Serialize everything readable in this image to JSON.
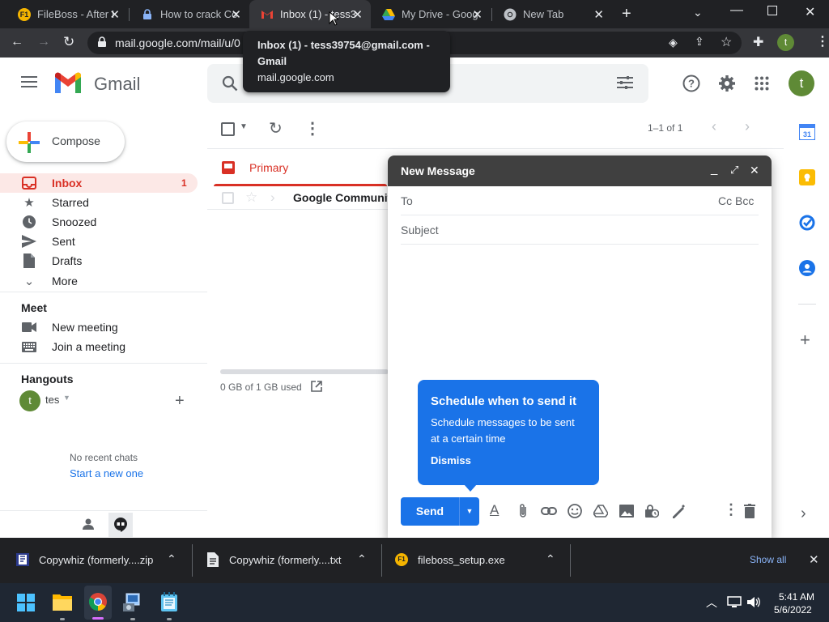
{
  "browser": {
    "tabs": [
      {
        "title": "FileBoss - After I",
        "favicon": "fileboss-icon",
        "favicon_text": "F1",
        "active": false
      },
      {
        "title": "How to crack Co",
        "favicon": "lock-icon",
        "active": false
      },
      {
        "title": "Inbox (1) - tess3",
        "favicon": "gmail-icon",
        "active": true
      },
      {
        "title": "My Drive - Goog",
        "favicon": "drive-icon",
        "active": false
      },
      {
        "title": "New Tab",
        "favicon": "chrome-icon",
        "active": false
      }
    ],
    "url": "mail.google.com/mail/u/0",
    "profile_initial": "t",
    "tooltip": {
      "line1": "Inbox (1) - tess39754@gmail.com -",
      "line2": "Gmail",
      "line3": "mail.google.com"
    }
  },
  "gmail": {
    "logo_text": "Gmail",
    "avatar_initial": "t",
    "compose_label": "Compose",
    "nav": [
      {
        "label": "Inbox",
        "icon": "inbox-icon",
        "count": "1",
        "selected": true
      },
      {
        "label": "Starred",
        "icon": "star-icon",
        "count": ""
      },
      {
        "label": "Snoozed",
        "icon": "clock-icon",
        "count": ""
      },
      {
        "label": "Sent",
        "icon": "send-icon",
        "count": ""
      },
      {
        "label": "Drafts",
        "icon": "draft-icon",
        "count": ""
      },
      {
        "label": "More",
        "icon": "chevron-down-icon",
        "count": ""
      }
    ],
    "meet": {
      "heading": "Meet",
      "items": [
        {
          "label": "New meeting",
          "icon": "video-icon"
        },
        {
          "label": "Join a meeting",
          "icon": "keyboard-icon"
        }
      ]
    },
    "hangouts": {
      "heading": "Hangouts",
      "user_initial": "t",
      "user_name": "tes",
      "no_chats": "No recent chats",
      "start_link": "Start a new one"
    },
    "list": {
      "pagination": "1–1 of 1",
      "primary_tab": "Primary",
      "rows": [
        {
          "sender": "Google Communit"
        }
      ],
      "storage": "0 GB of 1 GB used"
    },
    "compose": {
      "title": "New Message",
      "to_label": "To",
      "cc_bcc": "Cc Bcc",
      "subject_placeholder": "Subject",
      "send_label": "Send"
    },
    "schedule_popup": {
      "title": "Schedule when to send it",
      "body": "Schedule messages to be sent at a certain time",
      "dismiss": "Dismiss"
    },
    "calendar_day": "31"
  },
  "downloads": {
    "items": [
      {
        "name": "Copywhiz (formerly....zip",
        "icon": "zip-file-icon"
      },
      {
        "name": "Copywhiz (formerly....txt",
        "icon": "text-file-icon"
      },
      {
        "name": "fileboss_setup.exe",
        "icon": "fileboss-icon",
        "icon_text": "F1"
      }
    ],
    "show_all": "Show all"
  },
  "taskbar": {
    "time": "5:41 AM",
    "date": "5/6/2022"
  },
  "colors": {
    "accent_blue": "#1a73e8",
    "inbox_red": "#d93025",
    "chrome_dark": "#202124"
  }
}
